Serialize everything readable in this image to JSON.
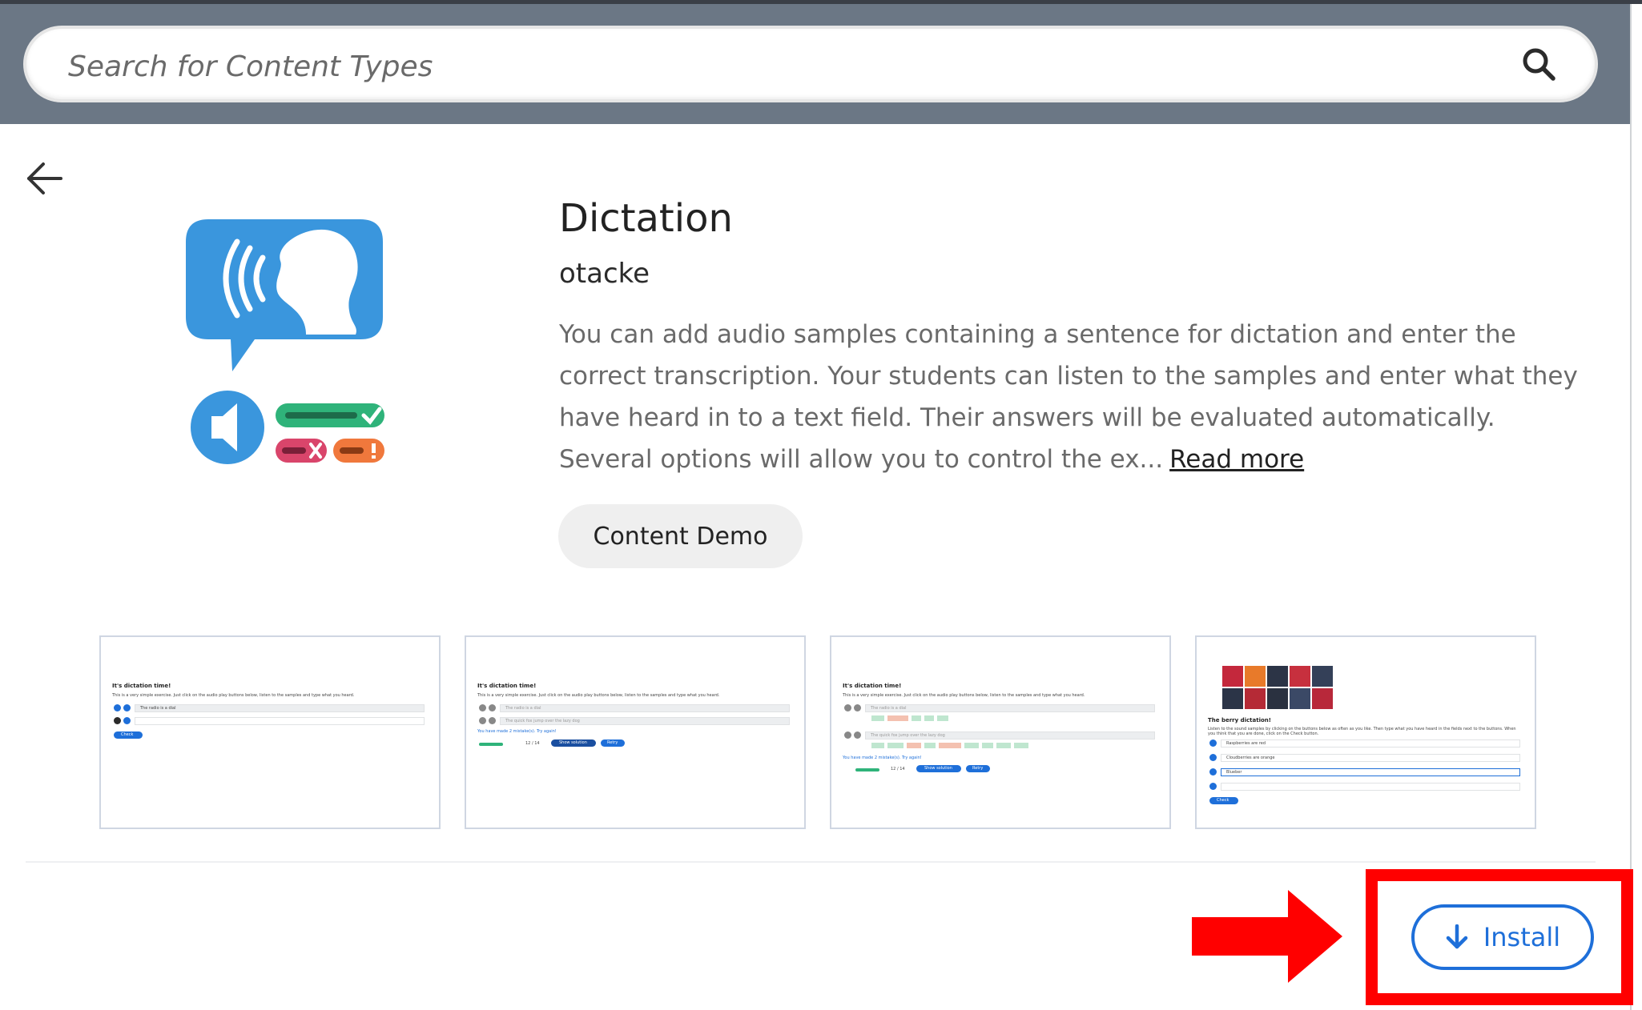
{
  "search": {
    "placeholder": "Search for Content Types"
  },
  "content": {
    "title": "Dictation",
    "author": "otacke",
    "description": "You can add audio samples containing a sentence for dictation and enter the correct transcription. Your students can listen to the samples and enter what they have heard in to a text field. Their answers will be evaluated automatically. Several options will allow you to control the ex...",
    "read_more": "Read more",
    "demo_label": "Content Demo"
  },
  "screenshots": [
    {
      "heading": "It's dictation time!",
      "text": "This is a very simple exercise. Just click on the audio play buttons below, listen to the samples and type what you heard.",
      "rows": [
        "The radio is a dial",
        ""
      ],
      "button": "Check"
    },
    {
      "heading": "It's dictation time!",
      "text": "This is a very simple exercise. Just click on the audio play buttons below, listen to the samples and type what you heard.",
      "rows": [
        "The radio is a dial",
        "The quick fox jump over the lazy dog"
      ],
      "feedback": "You have made 2 mistake(s). Try again!",
      "score": "12 / 14",
      "buttons": [
        "Show solution",
        "Retry"
      ]
    },
    {
      "heading": "It's dictation time!",
      "text": "This is a very simple exercise. Just click on the audio play buttons below, listen to the samples and type what you heard.",
      "rows": [
        "The radio is a dial",
        "The quick fox jump over the lazy dog"
      ],
      "feedback": "You have made 2 mistake(s). Try again!",
      "score": "12 / 14",
      "buttons": [
        "Show solution",
        "Retry"
      ]
    },
    {
      "heading": "The berry dictation!",
      "text": "Listen to the sound samples by clicking on the buttons below as often as you like. Then type what you have heard in the fields next to the buttons. When you think that you are done, click on the Check button.",
      "rows": [
        "Raspberries are red",
        "Cloudberries are orange",
        "Blueber",
        ""
      ],
      "button": "Check"
    }
  ],
  "install": {
    "label": "Install"
  },
  "colors": {
    "header": "#6b7785",
    "accent": "#1e6fd9",
    "highlight": "#ff0000",
    "icon_blue": "#3a96dd",
    "icon_green": "#2fb37a",
    "icon_red": "#d9456b",
    "icon_orange": "#f0783c"
  }
}
